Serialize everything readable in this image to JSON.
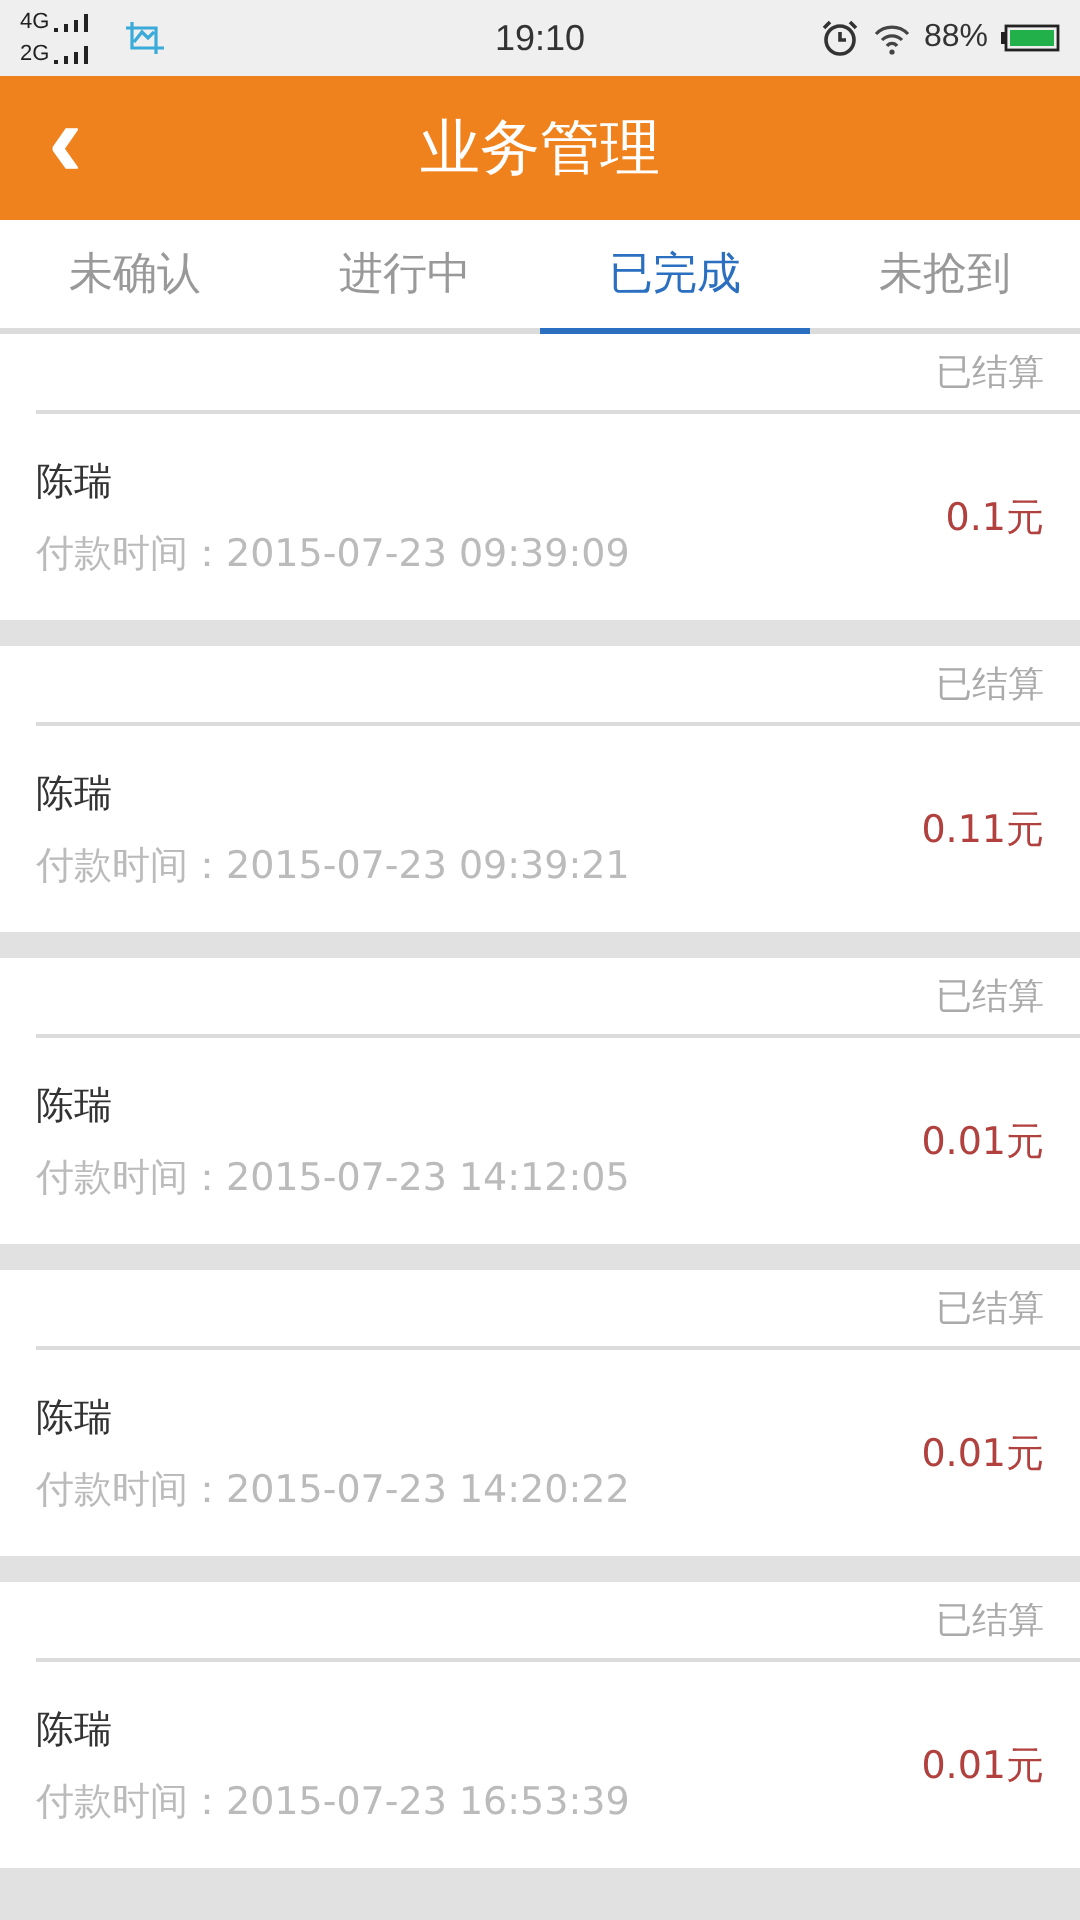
{
  "status_bar": {
    "network_1": "4G",
    "network_2": "2G",
    "time": "19:10",
    "battery": "88%"
  },
  "header": {
    "back": "‹",
    "title": "业务管理"
  },
  "tabs": [
    {
      "label": "未确认",
      "selected": false
    },
    {
      "label": "进行中",
      "selected": false
    },
    {
      "label": "已完成",
      "selected": true
    },
    {
      "label": "未抢到",
      "selected": false
    }
  ],
  "orders": [
    {
      "status": "已结算",
      "name": "陈瑞",
      "time": "付款时间：2015-07-23 09:39:09",
      "amount": "0.1元"
    },
    {
      "status": "已结算",
      "name": "陈瑞",
      "time": "付款时间：2015-07-23 09:39:21",
      "amount": "0.11元"
    },
    {
      "status": "已结算",
      "name": "陈瑞",
      "time": "付款时间：2015-07-23 14:12:05",
      "amount": "0.01元"
    },
    {
      "status": "已结算",
      "name": "陈瑞",
      "time": "付款时间：2015-07-23 14:20:22",
      "amount": "0.01元"
    },
    {
      "status": "已结算",
      "name": "陈瑞",
      "time": "付款时间：2015-07-23 16:53:39",
      "amount": "0.01元"
    }
  ]
}
